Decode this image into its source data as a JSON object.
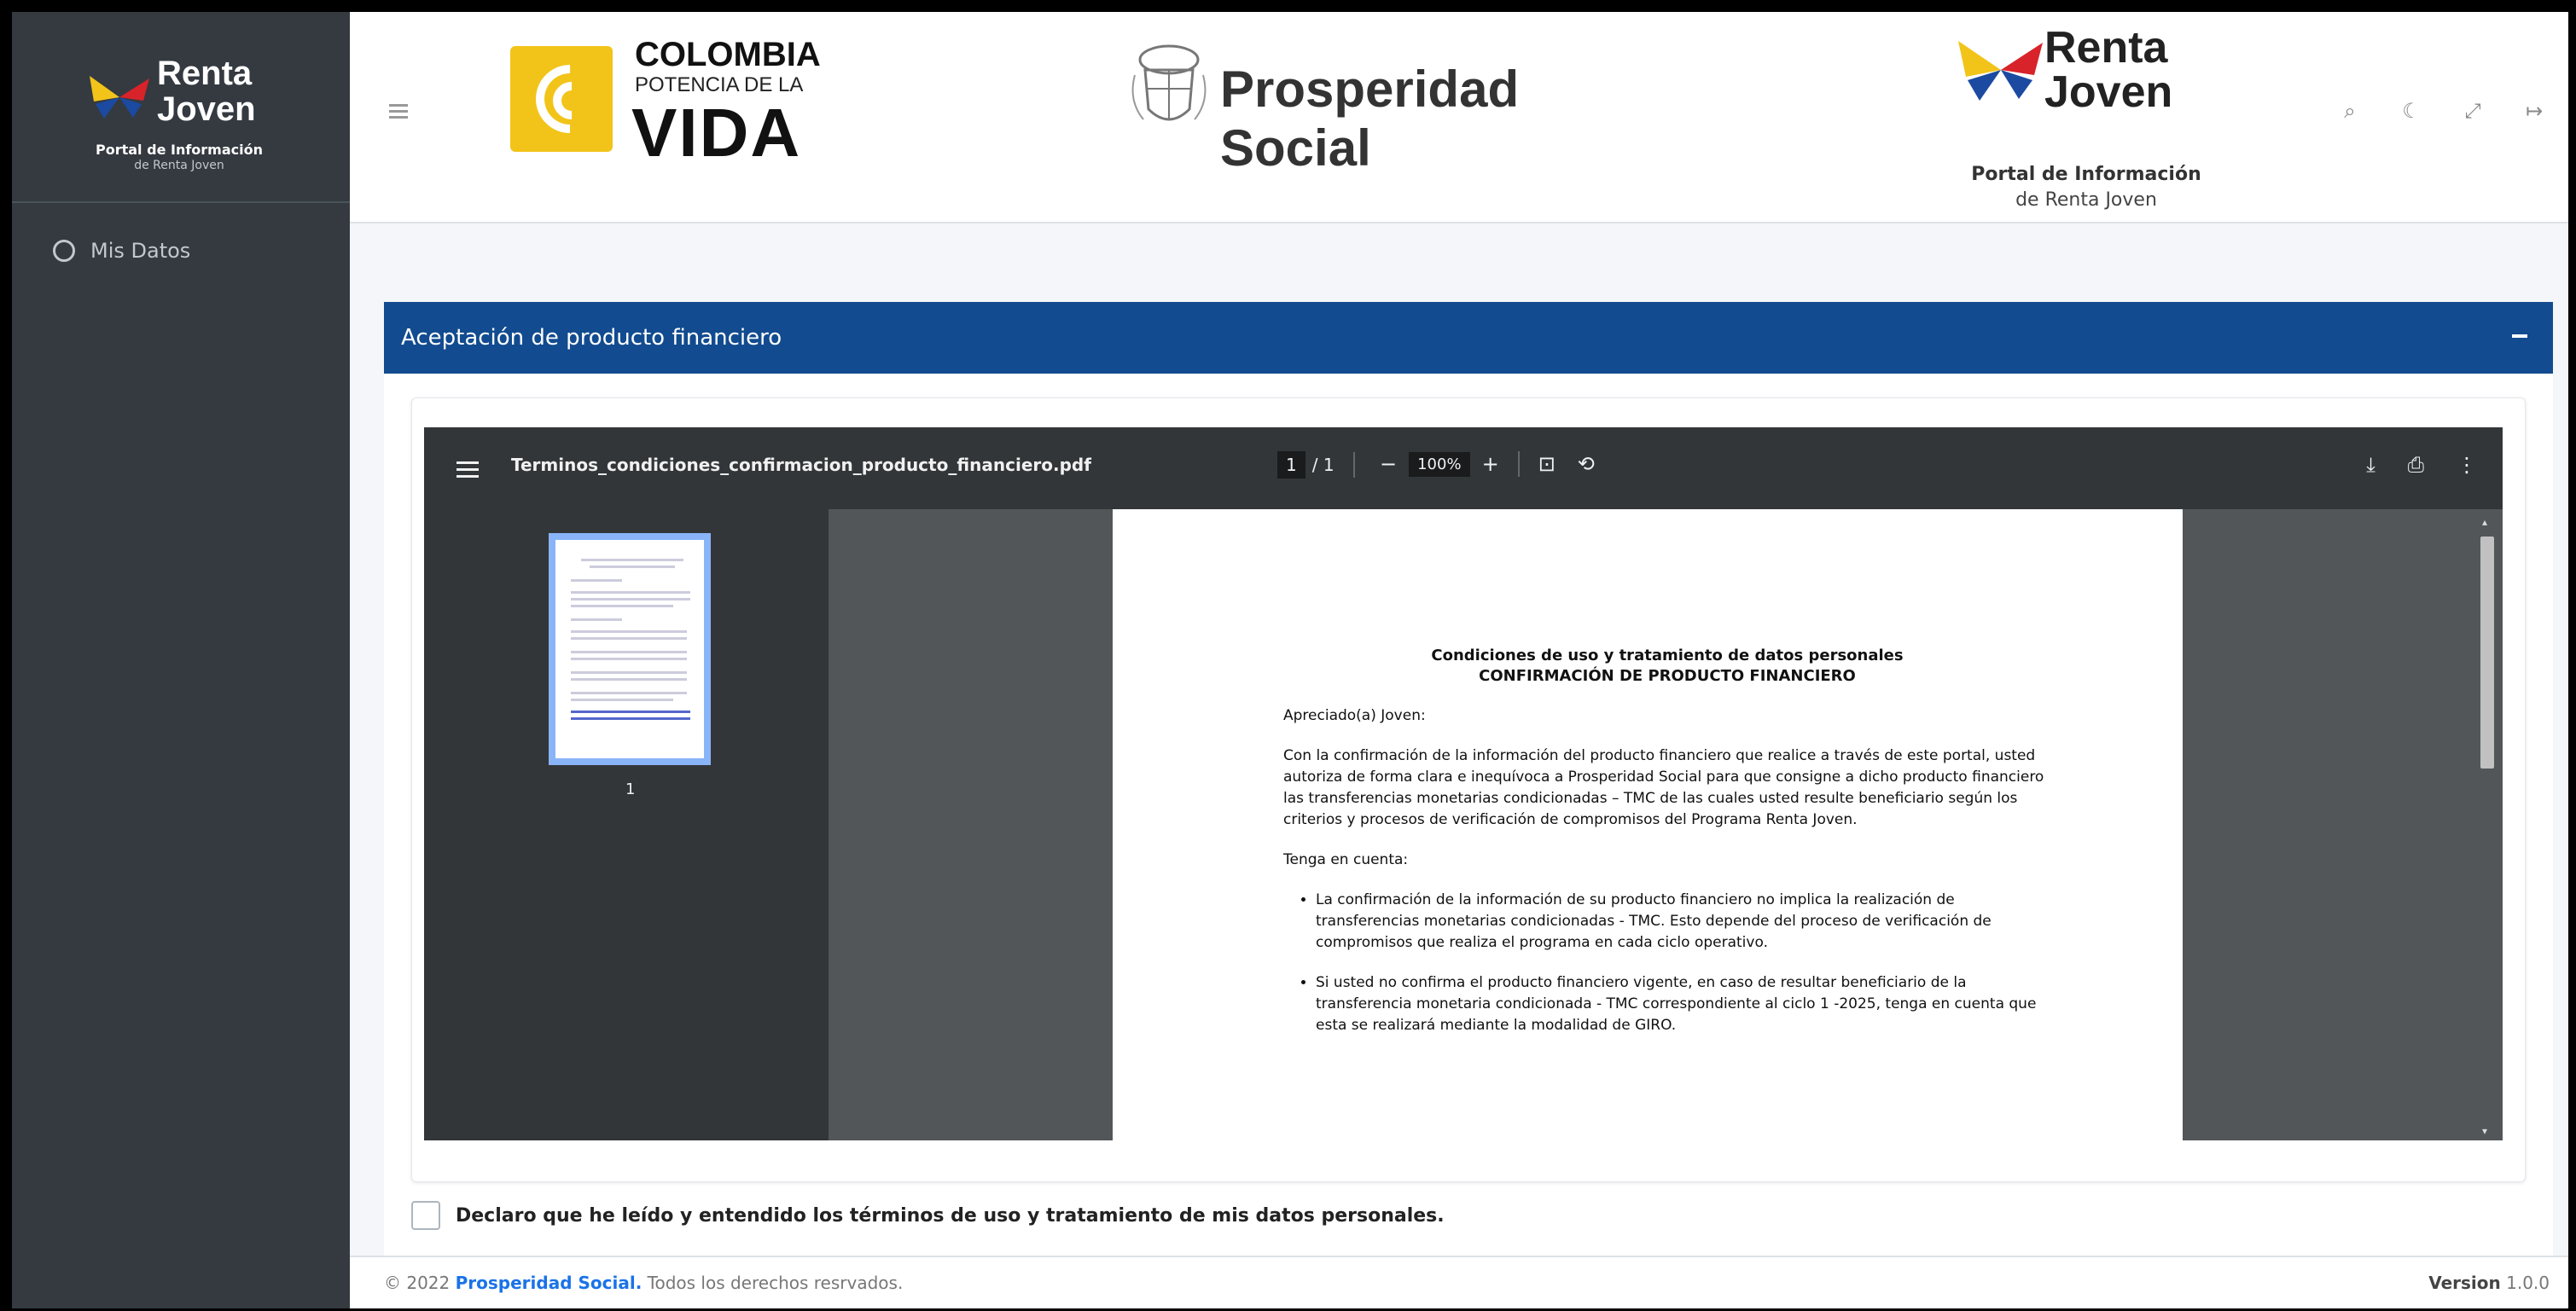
{
  "sidebar": {
    "logo": {
      "line1": "Renta",
      "line2": "Joven",
      "line3": "Portal de Información",
      "line4": "de Renta Joven"
    },
    "items": [
      {
        "label": "Mis Datos"
      }
    ]
  },
  "header": {
    "logo_colombia": {
      "line1": "COLOMBIA",
      "line2": "POTENCIA DE LA",
      "line3": "VIDA"
    },
    "logo_prosperidad": "Prosperidad Social",
    "logo_renta": {
      "line1": "Renta",
      "line2": "Joven",
      "line3": "Portal de Información",
      "line4": "de Renta Joven"
    },
    "icons": [
      "zoom-icon",
      "moon-icon",
      "fullscreen-icon",
      "logout-icon"
    ]
  },
  "card": {
    "title": "Aceptación de producto financiero"
  },
  "pdf": {
    "filename": "Terminos_condiciones_confirmacion_producto_financiero.pdf",
    "page_current": "1",
    "page_total": "/ 1",
    "zoom": "100%",
    "thumb_label": "1",
    "doc": {
      "title1": "Condiciones de uso y tratamiento de datos personales",
      "title2": "CONFIRMACIÓN DE PRODUCTO FINANCIERO",
      "greeting": "Apreciado(a) Joven:",
      "para1": "Con la confirmación de la información del producto financiero que realice a través de este portal, usted autoriza de forma clara e inequívoca a Prosperidad Social para que consigne a dicho producto financiero las transferencias monetarias condicionadas – TMC de las cuales usted resulte beneficiario según los criterios y procesos de verificación de compromisos del Programa Renta Joven.",
      "note": "Tenga en cuenta:",
      "bullet1": "La confirmación de la información de su producto financiero no implica la realización de transferencias monetarias condicionadas - TMC. Esto depende del proceso de verificación de compromisos que realiza el programa en cada ciclo operativo.",
      "bullet2": "Si usted no confirma el producto financiero vigente, en caso de resultar beneficiario de la transferencia monetaria condicionada - TMC correspondiente al ciclo 1 -2025, tenga en cuenta que esta se realizará mediante la modalidad de GIRO."
    }
  },
  "accept": {
    "label": "Declaro que he leído y entendido los términos de uso y tratamiento de mis datos personales."
  },
  "footer": {
    "copyright": "© 2022",
    "brand": "Prosperidad Social.",
    "rights": "Todos los derechos resrvados.",
    "version_label": "Version",
    "version": "1.0.0"
  },
  "colors": {
    "sidebar": "#343a40",
    "card_header": "#124b8f",
    "pdf_toolbar": "#323639",
    "brand_link": "#1a73e8"
  }
}
